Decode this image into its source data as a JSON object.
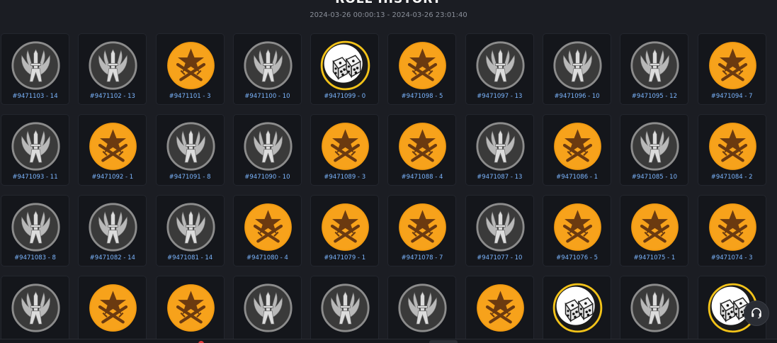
{
  "header": {
    "title": "ROLL HISTORY",
    "range": "2024-03-26 00:00:13 - 2024-03-26 23:01:40"
  },
  "colors": {
    "ct": "#8c8c8c",
    "t": "#f39c12",
    "bonus": "#f3c319",
    "label": "#7cb6ff"
  },
  "icons": {
    "ct": "ct-emblem-icon",
    "t": "t-emblem-icon",
    "bonus": "dice-icon",
    "chat": "headset-icon"
  },
  "rolls": [
    {
      "label": "#9471103 - 14",
      "type": "ct"
    },
    {
      "label": "#9471102 - 13",
      "type": "ct"
    },
    {
      "label": "#9471101 - 3",
      "type": "t"
    },
    {
      "label": "#9471100 - 10",
      "type": "ct"
    },
    {
      "label": "#9471099 - 0",
      "type": "bonus"
    },
    {
      "label": "#9471098 - 5",
      "type": "t"
    },
    {
      "label": "#9471097 - 13",
      "type": "ct"
    },
    {
      "label": "#9471096 - 10",
      "type": "ct"
    },
    {
      "label": "#9471095 - 12",
      "type": "ct"
    },
    {
      "label": "#9471094 - 7",
      "type": "t"
    },
    {
      "label": "#9471093 - 11",
      "type": "ct"
    },
    {
      "label": "#9471092 - 1",
      "type": "t"
    },
    {
      "label": "#9471091 - 8",
      "type": "ct"
    },
    {
      "label": "#9471090 - 10",
      "type": "ct"
    },
    {
      "label": "#9471089 - 3",
      "type": "t"
    },
    {
      "label": "#9471088 - 4",
      "type": "t"
    },
    {
      "label": "#9471087 - 13",
      "type": "ct"
    },
    {
      "label": "#9471086 - 1",
      "type": "t"
    },
    {
      "label": "#9471085 - 10",
      "type": "ct"
    },
    {
      "label": "#9471084 - 2",
      "type": "t"
    },
    {
      "label": "#9471083 - 8",
      "type": "ct"
    },
    {
      "label": "#9471082 - 14",
      "type": "ct"
    },
    {
      "label": "#9471081 - 14",
      "type": "ct"
    },
    {
      "label": "#9471080 - 4",
      "type": "t"
    },
    {
      "label": "#9471079 - 1",
      "type": "t"
    },
    {
      "label": "#9471078 - 7",
      "type": "t"
    },
    {
      "label": "#9471077 - 10",
      "type": "ct"
    },
    {
      "label": "#9471076 - 5",
      "type": "t"
    },
    {
      "label": "#9471075 - 1",
      "type": "t"
    },
    {
      "label": "#9471074 - 3",
      "type": "t"
    },
    {
      "label": "",
      "type": "ct"
    },
    {
      "label": "",
      "type": "t"
    },
    {
      "label": "",
      "type": "t"
    },
    {
      "label": "",
      "type": "ct"
    },
    {
      "label": "",
      "type": "ct"
    },
    {
      "label": "",
      "type": "ct"
    },
    {
      "label": "",
      "type": "t"
    },
    {
      "label": "",
      "type": "bonus"
    },
    {
      "label": "",
      "type": "ct"
    },
    {
      "label": "",
      "type": "bonus"
    }
  ]
}
